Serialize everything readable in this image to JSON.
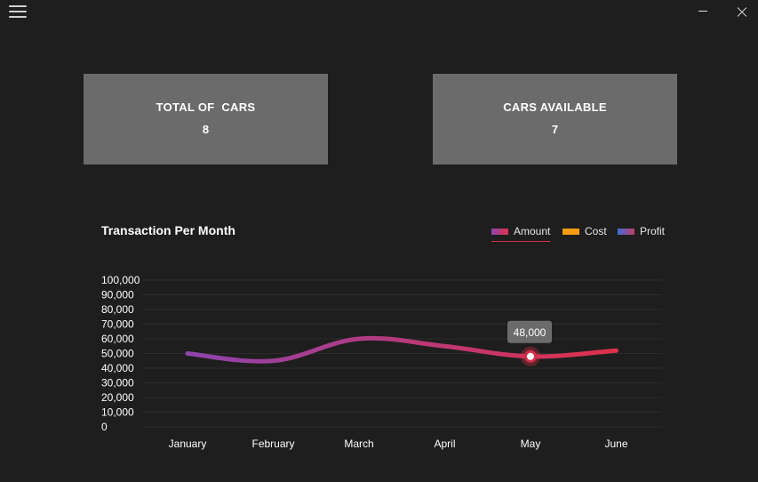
{
  "window": {
    "menu_icon": "hamburger-icon",
    "minimize_icon": "minimize-icon",
    "close_icon": "close-icon"
  },
  "cards": {
    "total": {
      "label": "TOTAL OF  CARS",
      "value": "8"
    },
    "available": {
      "label": "CARS AVAILABLE",
      "value": "7"
    }
  },
  "chart_title": "Transaction Per Month",
  "legend": [
    {
      "label": "Amount",
      "color_from": "#8e44ad",
      "color_to": "#e0304a",
      "active": true
    },
    {
      "label": "Cost",
      "color_from": "#f39c12",
      "color_to": "#f39c12",
      "active": false
    },
    {
      "label": "Profit",
      "color_from": "#3b6fd6",
      "color_to": "#c23a6a",
      "active": false
    }
  ],
  "tooltip": {
    "category": "May",
    "value_label": "48,000"
  },
  "chart_data": {
    "type": "line",
    "title": "Transaction Per Month",
    "categories": [
      "January",
      "February",
      "March",
      "April",
      "May",
      "June"
    ],
    "ylim": [
      0,
      100000
    ],
    "yticks": [
      "0",
      "10,000",
      "20,000",
      "30,000",
      "40,000",
      "50,000",
      "60,000",
      "70,000",
      "80,000",
      "90,000",
      "100,000"
    ],
    "grid": true,
    "legend_position": "top-right",
    "series": [
      {
        "name": "Amount",
        "values": [
          50000,
          45000,
          60000,
          55000,
          48000,
          52000
        ]
      }
    ]
  }
}
